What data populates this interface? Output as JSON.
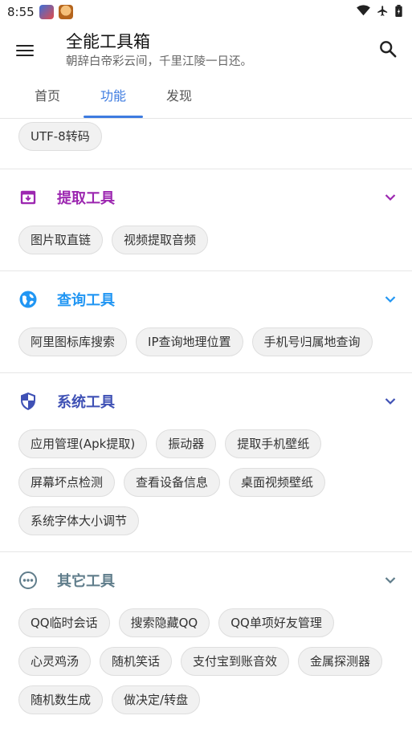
{
  "status": {
    "time": "8:55"
  },
  "header": {
    "title": "全能工具箱",
    "subtitle": "朝辞白帝彩云间，千里江陵一日还。"
  },
  "tabs": [
    {
      "label": "首页"
    },
    {
      "label": "功能"
    },
    {
      "label": "发现"
    }
  ],
  "partial_section": {
    "chips": [
      "UTF-8转码"
    ]
  },
  "sections": [
    {
      "title": "提取工具",
      "color": "#9c27b0",
      "icon": "archive-icon",
      "chips": [
        "图片取直链",
        "视频提取音频"
      ]
    },
    {
      "title": "查询工具",
      "color": "#2196f3",
      "icon": "globe-icon",
      "chips": [
        "阿里图标库搜索",
        "IP查询地理位置",
        "手机号归属地查询"
      ]
    },
    {
      "title": "系统工具",
      "color": "#3f51b5",
      "icon": "shield-icon",
      "chips": [
        "应用管理(Apk提取)",
        "振动器",
        "提取手机壁纸",
        "屏幕坏点检测",
        "查看设备信息",
        "桌面视频壁纸",
        "系统字体大小调节"
      ]
    },
    {
      "title": "其它工具",
      "color": "#607d8b",
      "icon": "more-dots-icon",
      "chips": [
        "QQ临时会话",
        "搜索隐藏QQ",
        "QQ单项好友管理",
        "心灵鸡汤",
        "随机笑话",
        "支付宝到账音效",
        "金属探测器",
        "随机数生成",
        "做决定/转盘"
      ]
    }
  ]
}
